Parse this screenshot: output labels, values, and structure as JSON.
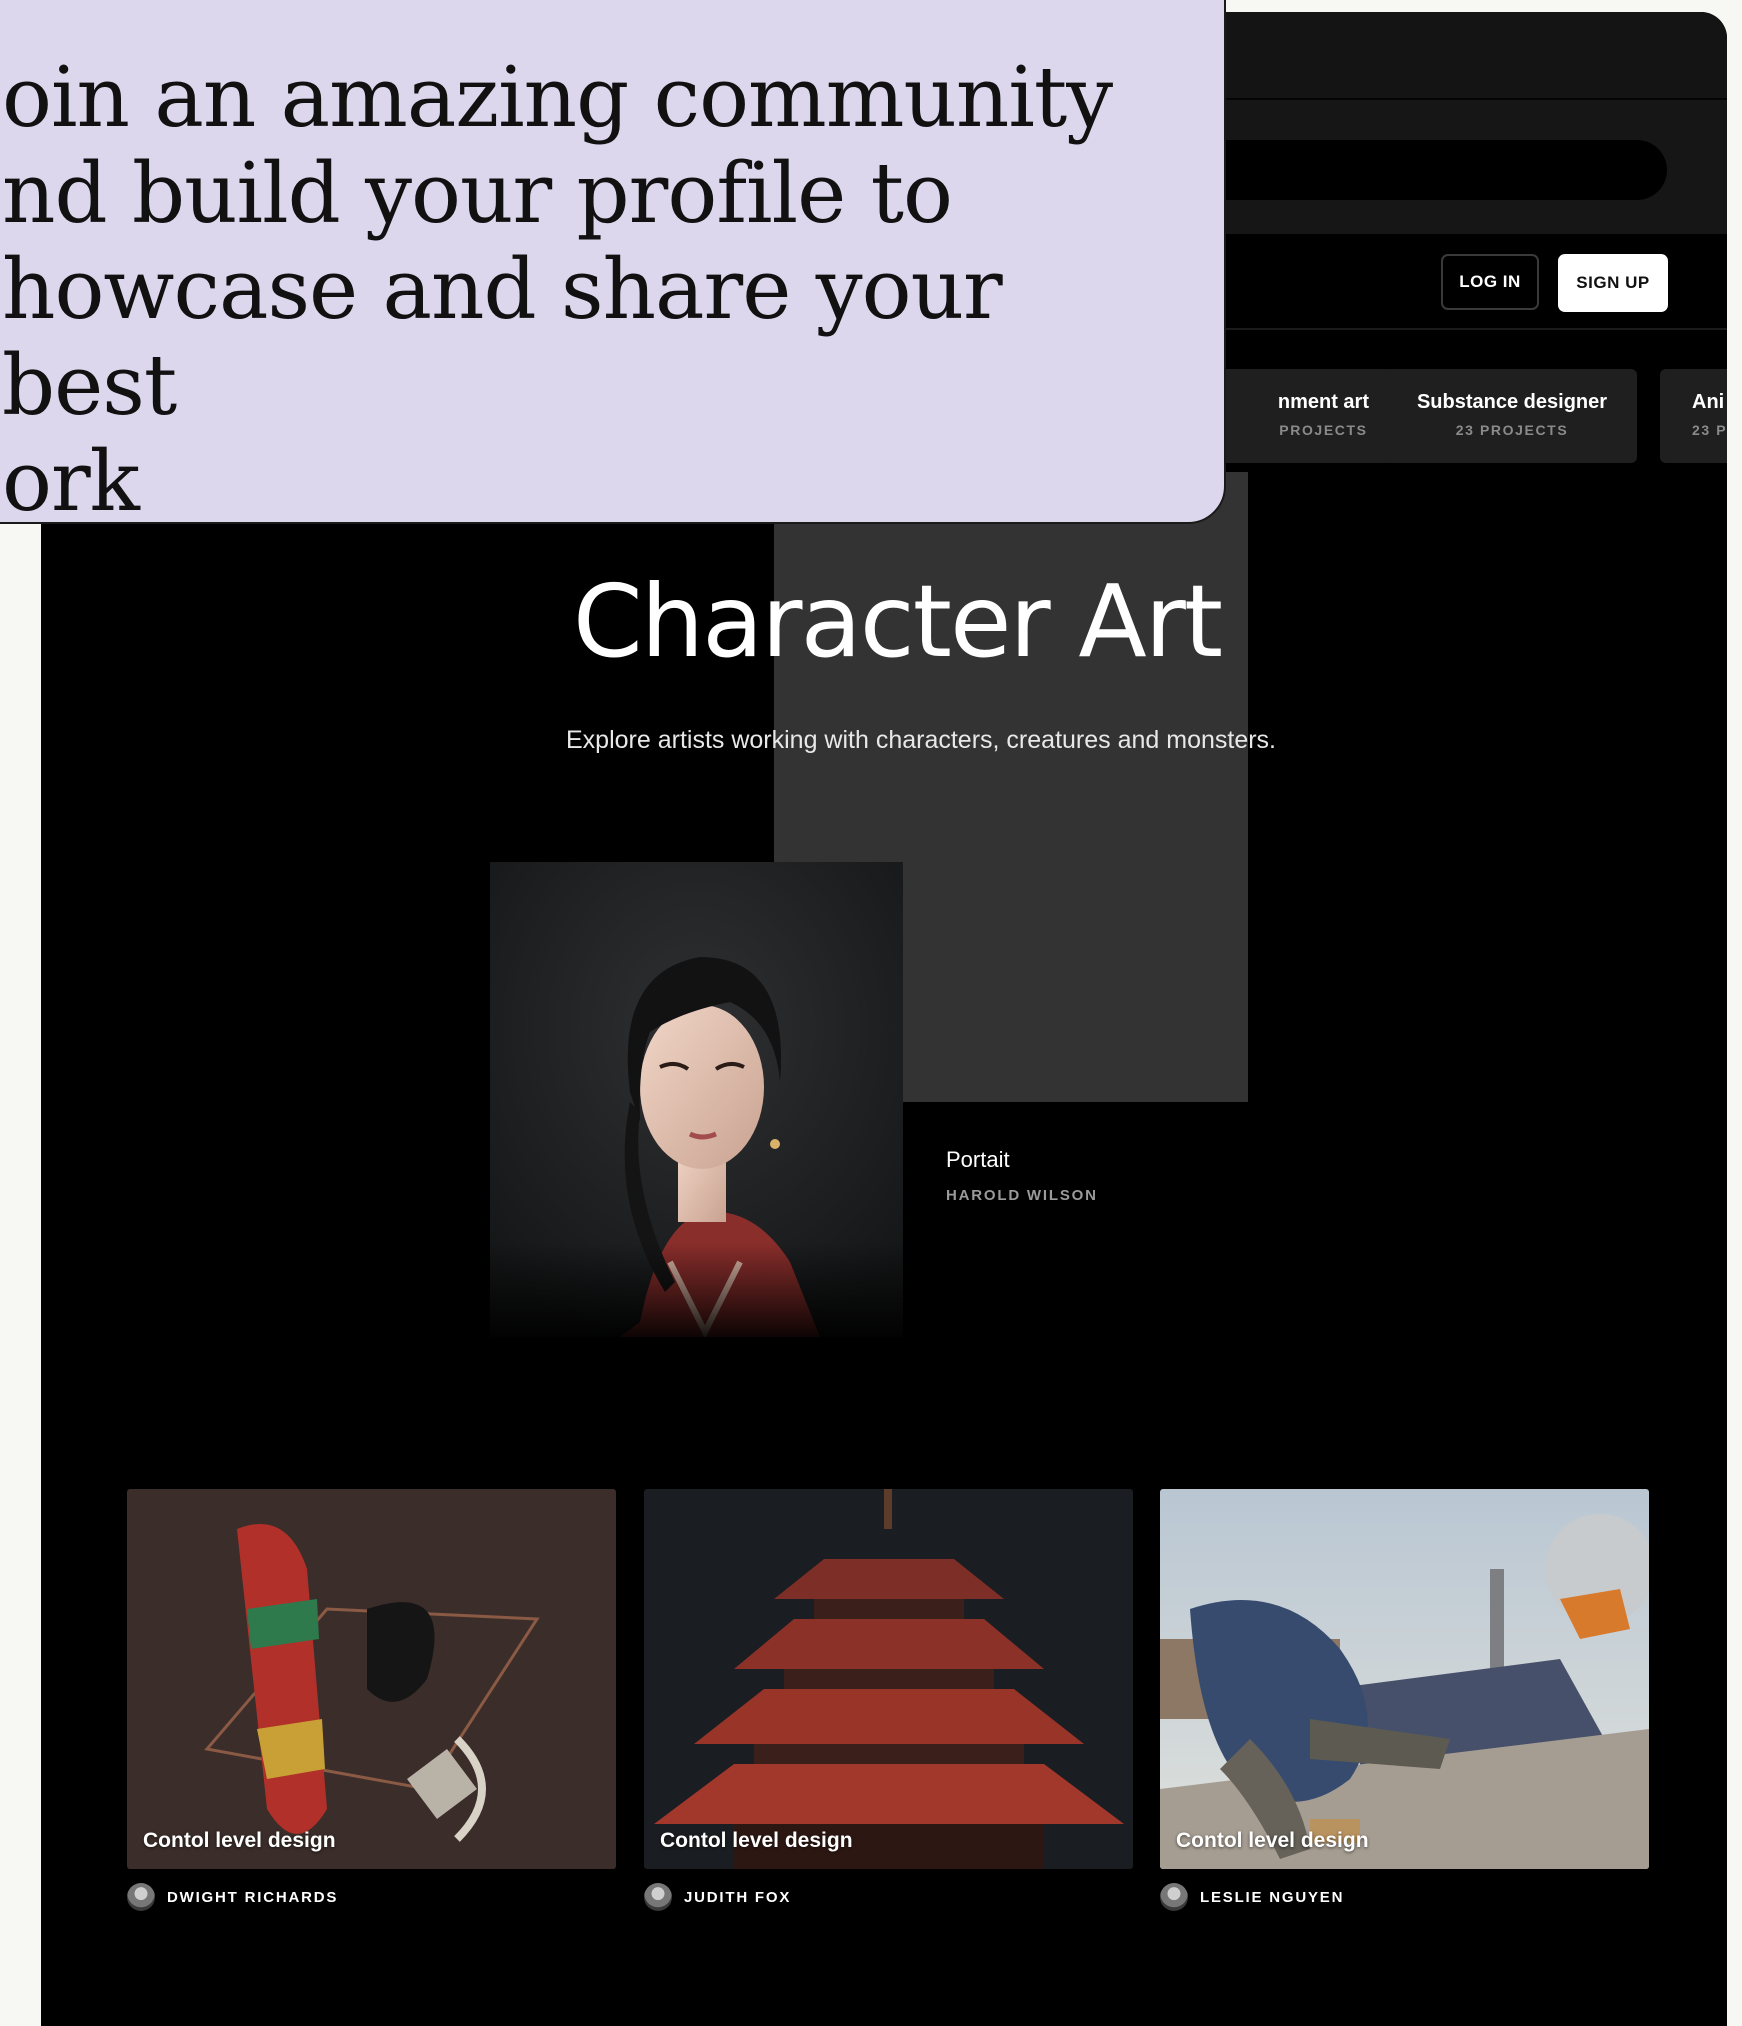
{
  "callout": {
    "text": "oin an amazing community\nnd build your profile to\nhowcase and share your best\nork"
  },
  "header": {
    "search_placeholder": "",
    "login_label": "LOG IN",
    "signup_label": "SIGN UP"
  },
  "categories": [
    {
      "name": "nment art",
      "count": "PROJECTS"
    },
    {
      "name": "Substance designer",
      "count": "23 PROJECTS"
    },
    {
      "name": "Ani",
      "count": "23 P"
    }
  ],
  "hero": {
    "title": "Character Art",
    "subtitle": "Explore artists working with characters, creatures and monsters."
  },
  "featured": {
    "title": "Portait",
    "author": "HAROLD WILSON"
  },
  "projects": [
    {
      "title": "Contol level design",
      "author": "DWIGHT RICHARDS"
    },
    {
      "title": "Contol level design",
      "author": "JUDITH FOX"
    },
    {
      "title": "Contol level design",
      "author": "LESLIE NGUYEN"
    }
  ],
  "colors": {
    "page_background": "#f7f8f3",
    "app_background": "#000000",
    "callout_background": "#dcd7ec",
    "hero_backdrop": "#333333"
  }
}
